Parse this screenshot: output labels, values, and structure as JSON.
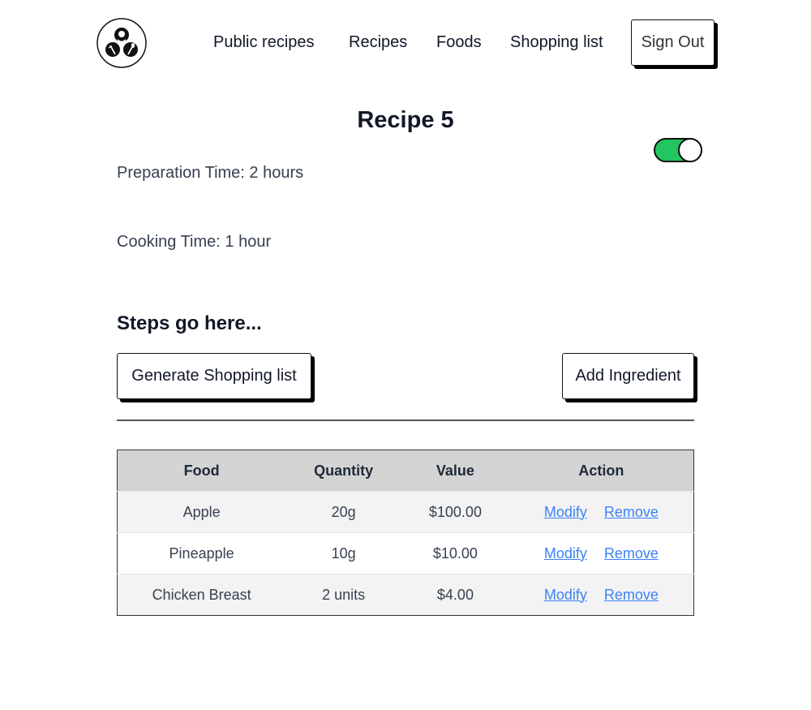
{
  "nav": {
    "public_recipes": "Public recipes",
    "recipes": "Recipes",
    "foods": "Foods",
    "shopping_list": "Shopping list",
    "sign_out": "Sign Out"
  },
  "recipe": {
    "title": "Recipe 5",
    "public_toggle_on": true,
    "preparation_time": "Preparation Time: 2 hours",
    "cooking_time": "Cooking Time: 1 hour",
    "steps": "Steps go here..."
  },
  "buttons": {
    "generate_shopping_list": "Generate Shopping list",
    "add_ingredient": "Add Ingredient"
  },
  "table": {
    "headers": [
      "Food",
      "Quantity",
      "Value",
      "Action"
    ],
    "rows": [
      {
        "food": "Apple",
        "quantity": "20g",
        "value": "$100.00",
        "modify": "Modify",
        "remove": "Remove"
      },
      {
        "food": "Pineapple",
        "quantity": "10g",
        "value": "$10.00",
        "modify": "Modify",
        "remove": "Remove"
      },
      {
        "food": "Chicken Breast",
        "quantity": "2 units",
        "value": "$4.00",
        "modify": "Modify",
        "remove": "Remove"
      }
    ]
  },
  "colors": {
    "toggle_on": "#22c55e",
    "link": "#3b82f6",
    "table_header": "#d4d4d4"
  },
  "icons": {
    "logo": "chef-logo-icon"
  }
}
